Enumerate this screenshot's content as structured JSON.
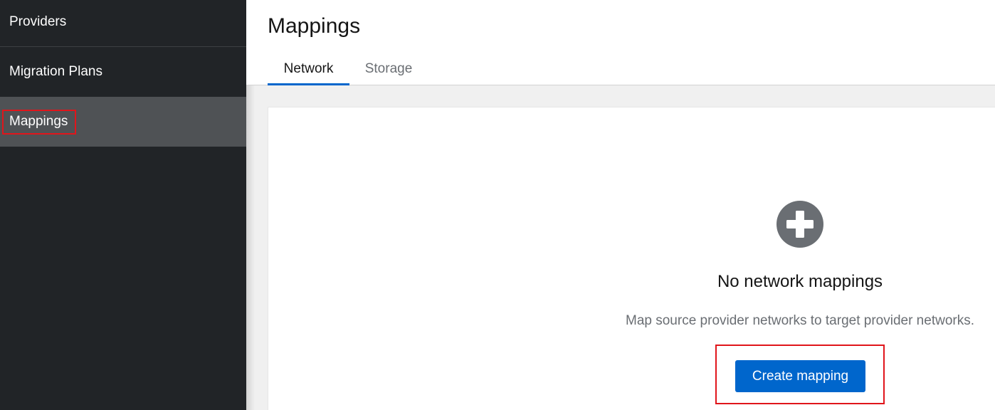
{
  "sidebar": {
    "items": [
      {
        "label": "Providers",
        "active": false
      },
      {
        "label": "Migration Plans",
        "active": false
      },
      {
        "label": "Mappings",
        "active": true
      }
    ]
  },
  "header": {
    "title": "Mappings",
    "tabs": [
      {
        "label": "Network",
        "active": true
      },
      {
        "label": "Storage",
        "active": false
      }
    ]
  },
  "empty_state": {
    "icon": "plus-circle-icon",
    "title": "No network mappings",
    "body": "Map source provider networks to target provider networks.",
    "button_label": "Create mapping"
  },
  "colors": {
    "sidebar_bg": "#212427",
    "active_item_bg": "#4f5255",
    "primary": "#0066cc",
    "highlight": "#e0151b"
  }
}
